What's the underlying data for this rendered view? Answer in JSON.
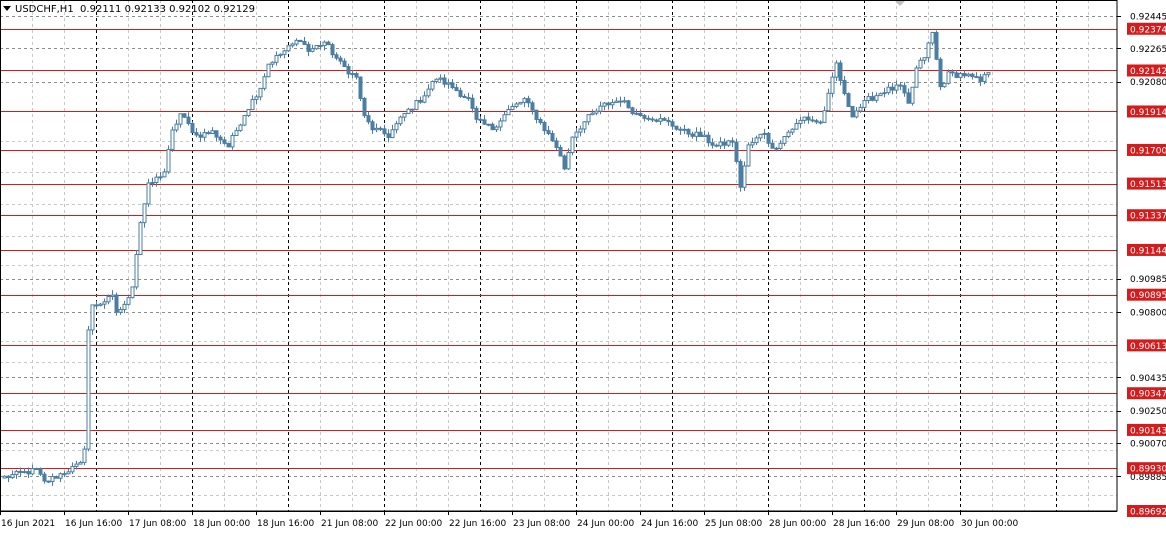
{
  "header": {
    "symbol": "USDCHF,H1",
    "ohlc": "0.92111 0.92133 0.92102 0.92129"
  },
  "colors": {
    "candle": "#4a7fa3",
    "level_line": "#d41c1c",
    "level_label_bg": "#d41c1c",
    "level_label_text": "#ffffff",
    "grid": "#8c8c8c",
    "axis_text": "#000000"
  },
  "chart_data": {
    "type": "candlestick",
    "grid": true,
    "ylim": [
      0.89692,
      0.92445
    ],
    "y_ticks": [
      "0.92445",
      "0.92265",
      "0.92080",
      "0.90985",
      "0.90800",
      "0.90435",
      "0.90250",
      "0.90070",
      "0.89885"
    ],
    "horizontal_levels": [
      "0.92374",
      "0.92142",
      "0.91914",
      "0.91700",
      "0.91513",
      "0.91337",
      "0.91144",
      "0.90895",
      "0.90613",
      "0.90347",
      "0.90143",
      "0.89930",
      "0.89692"
    ],
    "x_tick_labels": [
      "16 Jun 2021",
      "16 Jun 16:00",
      "17 Jun 08:00",
      "18 Jun 00:00",
      "18 Jun 16:00",
      "21 Jun 08:00",
      "22 Jun 00:00",
      "22 Jun 16:00",
      "23 Jun 08:00",
      "24 Jun 00:00",
      "24 Jun 16:00",
      "25 Jun 08:00",
      "28 Jun 00:00",
      "28 Jun 16:00",
      "29 Jun 08:00",
      "30 Jun 00:00"
    ],
    "anchors": [
      {
        "bar": 0,
        "price": 0.8988
      },
      {
        "bar": 8,
        "price": 0.8992
      },
      {
        "bar": 10,
        "price": 0.8985
      },
      {
        "bar": 16,
        "price": 0.8992
      },
      {
        "bar": 19,
        "price": 0.8995
      },
      {
        "bar": 20,
        "price": 0.9005
      },
      {
        "bar": 21,
        "price": 0.907
      },
      {
        "bar": 22,
        "price": 0.9083
      },
      {
        "bar": 27,
        "price": 0.9088
      },
      {
        "bar": 28,
        "price": 0.908
      },
      {
        "bar": 30,
        "price": 0.9083
      },
      {
        "bar": 32,
        "price": 0.9095
      },
      {
        "bar": 34,
        "price": 0.913
      },
      {
        "bar": 36,
        "price": 0.915
      },
      {
        "bar": 40,
        "price": 0.9158
      },
      {
        "bar": 42,
        "price": 0.918
      },
      {
        "bar": 44,
        "price": 0.919
      },
      {
        "bar": 48,
        "price": 0.9178
      },
      {
        "bar": 52,
        "price": 0.918
      },
      {
        "bar": 56,
        "price": 0.9172
      },
      {
        "bar": 60,
        "price": 0.919
      },
      {
        "bar": 64,
        "price": 0.9205
      },
      {
        "bar": 66,
        "price": 0.9218
      },
      {
        "bar": 70,
        "price": 0.9225
      },
      {
        "bar": 74,
        "price": 0.9232
      },
      {
        "bar": 76,
        "price": 0.9225
      },
      {
        "bar": 80,
        "price": 0.923
      },
      {
        "bar": 84,
        "price": 0.9218
      },
      {
        "bar": 88,
        "price": 0.921
      },
      {
        "bar": 90,
        "price": 0.9188
      },
      {
        "bar": 92,
        "price": 0.9182
      },
      {
        "bar": 96,
        "price": 0.9178
      },
      {
        "bar": 100,
        "price": 0.919
      },
      {
        "bar": 104,
        "price": 0.9198
      },
      {
        "bar": 108,
        "price": 0.921
      },
      {
        "bar": 112,
        "price": 0.9205
      },
      {
        "bar": 116,
        "price": 0.9198
      },
      {
        "bar": 118,
        "price": 0.9186
      },
      {
        "bar": 122,
        "price": 0.9182
      },
      {
        "bar": 126,
        "price": 0.9192
      },
      {
        "bar": 130,
        "price": 0.9198
      },
      {
        "bar": 134,
        "price": 0.9185
      },
      {
        "bar": 138,
        "price": 0.9172
      },
      {
        "bar": 140,
        "price": 0.916
      },
      {
        "bar": 142,
        "price": 0.9178
      },
      {
        "bar": 146,
        "price": 0.9188
      },
      {
        "bar": 150,
        "price": 0.9195
      },
      {
        "bar": 154,
        "price": 0.9198
      },
      {
        "bar": 158,
        "price": 0.919
      },
      {
        "bar": 162,
        "price": 0.9188
      },
      {
        "bar": 166,
        "price": 0.9185
      },
      {
        "bar": 170,
        "price": 0.918
      },
      {
        "bar": 174,
        "price": 0.9178
      },
      {
        "bar": 178,
        "price": 0.9172
      },
      {
        "bar": 182,
        "price": 0.9175
      },
      {
        "bar": 184,
        "price": 0.915
      },
      {
        "bar": 186,
        "price": 0.9172
      },
      {
        "bar": 190,
        "price": 0.918
      },
      {
        "bar": 192,
        "price": 0.917
      },
      {
        "bar": 196,
        "price": 0.918
      },
      {
        "bar": 200,
        "price": 0.9188
      },
      {
        "bar": 204,
        "price": 0.9185
      },
      {
        "bar": 206,
        "price": 0.92
      },
      {
        "bar": 208,
        "price": 0.9218
      },
      {
        "bar": 210,
        "price": 0.92
      },
      {
        "bar": 212,
        "price": 0.919
      },
      {
        "bar": 216,
        "price": 0.9198
      },
      {
        "bar": 220,
        "price": 0.9203
      },
      {
        "bar": 224,
        "price": 0.9205
      },
      {
        "bar": 226,
        "price": 0.9195
      },
      {
        "bar": 228,
        "price": 0.9215
      },
      {
        "bar": 230,
        "price": 0.9222
      },
      {
        "bar": 232,
        "price": 0.9235
      },
      {
        "bar": 234,
        "price": 0.9205
      },
      {
        "bar": 236,
        "price": 0.9212
      },
      {
        "bar": 240,
        "price": 0.9212
      },
      {
        "bar": 244,
        "price": 0.9208
      },
      {
        "bar": 246,
        "price": 0.9213
      }
    ]
  }
}
